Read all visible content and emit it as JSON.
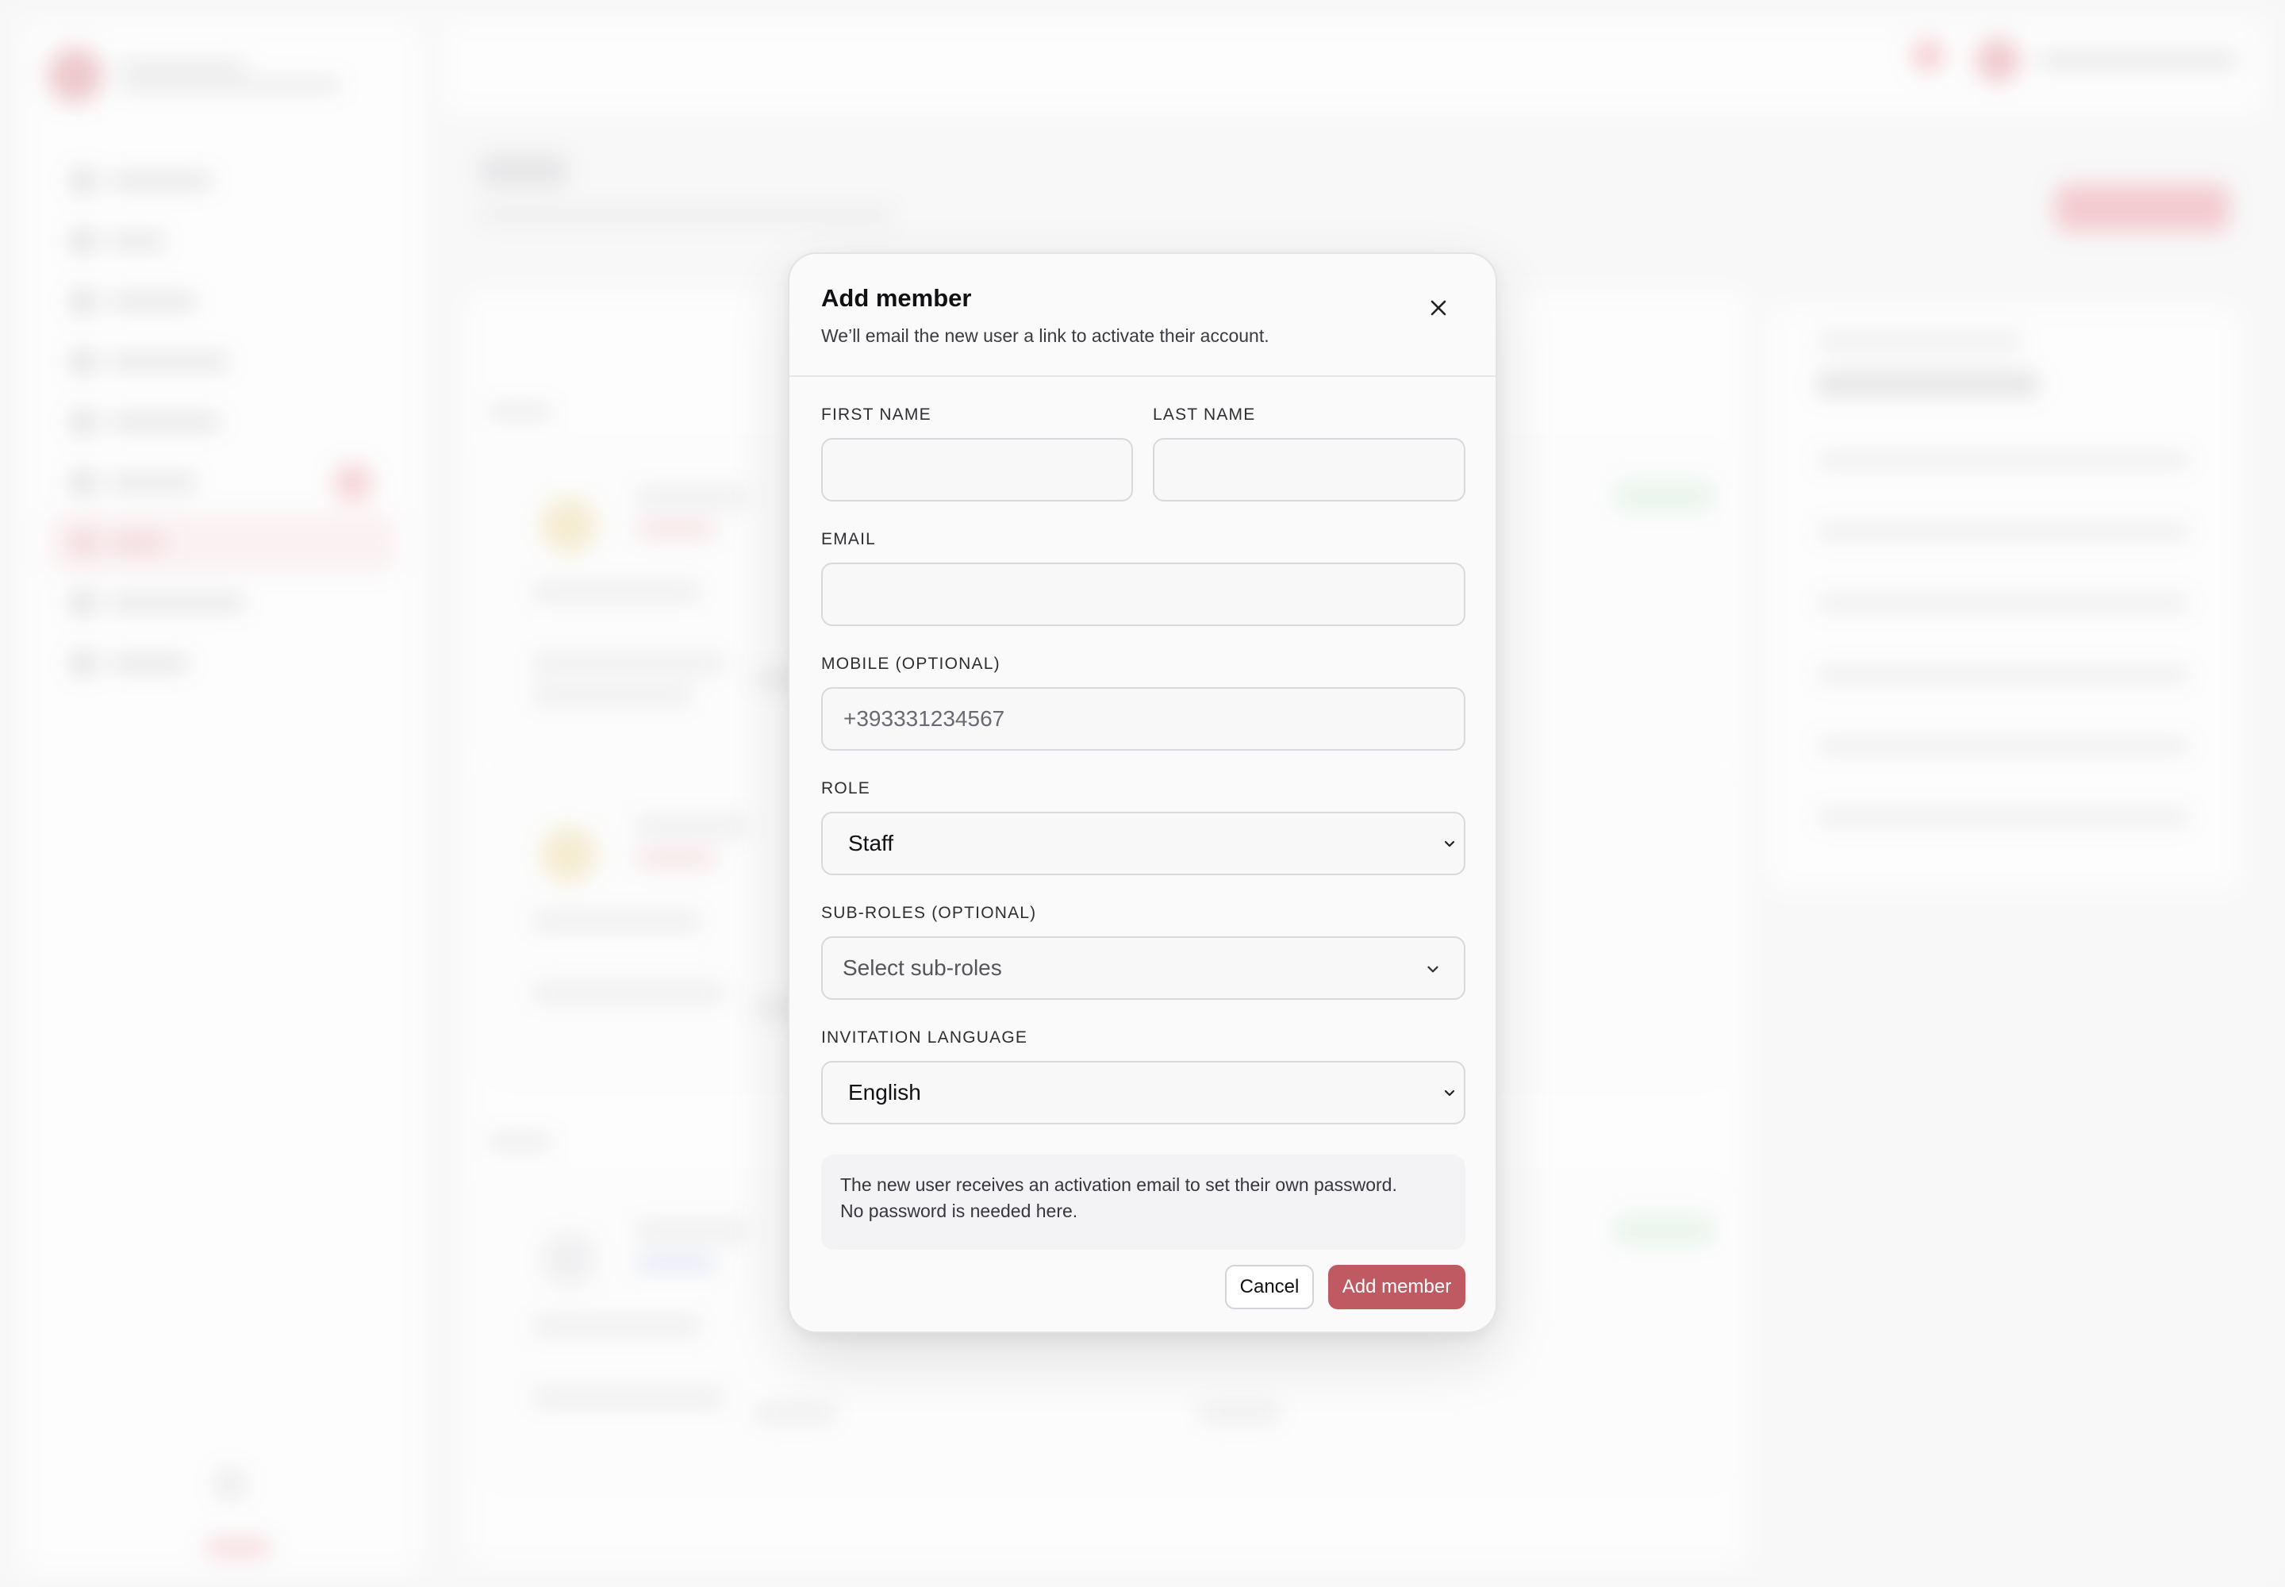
{
  "modal": {
    "title": "Add member",
    "subtitle": "We’ll email the new user a link to activate their account.",
    "close_icon": "close-icon",
    "fields": {
      "first_name": {
        "label": "FIRST NAME",
        "value": "",
        "placeholder": ""
      },
      "last_name": {
        "label": "LAST NAME",
        "value": "",
        "placeholder": ""
      },
      "email": {
        "label": "EMAIL",
        "value": "",
        "placeholder": ""
      },
      "mobile": {
        "label": "MOBILE (OPTIONAL)",
        "value": "",
        "placeholder": "+393331234567"
      },
      "role": {
        "label": "ROLE",
        "selected": "Staff"
      },
      "sub_roles": {
        "label": "SUB-ROLES (OPTIONAL)",
        "placeholder": "Select sub-roles"
      },
      "invitation_language": {
        "label": "INVITATION LANGUAGE",
        "selected": "English"
      }
    },
    "info_text_line1": "The new user receives an activation email to set their own password.",
    "info_text_line2": "No password is needed here.",
    "buttons": {
      "cancel": "Cancel",
      "submit": "Add member"
    }
  },
  "colors": {
    "primary": "#bf5a63",
    "backdrop": "#f6f6f7"
  }
}
